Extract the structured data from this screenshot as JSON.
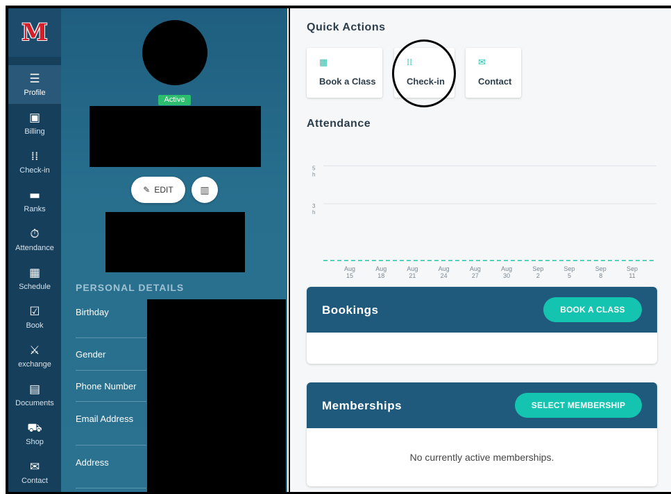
{
  "sidebar": {
    "logo": "M",
    "items": [
      {
        "label": "Profile",
        "icon": "profile-icon",
        "glyph": "☰"
      },
      {
        "label": "Billing",
        "icon": "billing-icon",
        "glyph": "▣"
      },
      {
        "label": "Check-in",
        "icon": "checkin-icon",
        "glyph": "⁞⁞"
      },
      {
        "label": "Ranks",
        "icon": "ranks-icon",
        "glyph": "▬"
      },
      {
        "label": "Attendance",
        "icon": "stopwatch-icon",
        "glyph": "⏱"
      },
      {
        "label": "Schedule",
        "icon": "calendar-icon",
        "glyph": "▦"
      },
      {
        "label": "Book",
        "icon": "checkbox-icon",
        "glyph": "☑"
      },
      {
        "label": "exchange",
        "icon": "martial-arts-icon",
        "glyph": "⚔"
      },
      {
        "label": "Documents",
        "icon": "document-icon",
        "glyph": "▤"
      },
      {
        "label": "Shop",
        "icon": "cart-icon",
        "glyph": "⛟"
      },
      {
        "label": "Contact",
        "icon": "envelope-icon",
        "glyph": "✉"
      }
    ]
  },
  "profile": {
    "status": "Active",
    "edit_label": "EDIT",
    "section_title": "PERSONAL DETAILS",
    "details": [
      "Birthday",
      "Gender",
      "Phone Number",
      "Email Address",
      "Address"
    ]
  },
  "quick_actions": {
    "title": "Quick Actions",
    "cards": [
      {
        "label": "Book a Class",
        "icon": "calendar-icon"
      },
      {
        "label": "Check-in",
        "icon": "keypad-icon"
      },
      {
        "label": "Contact",
        "icon": "envelope-icon"
      }
    ]
  },
  "attendance": {
    "title": "Attendance"
  },
  "chart_data": {
    "type": "line",
    "categories": [
      "Aug 15",
      "Aug 18",
      "Aug 21",
      "Aug 24",
      "Aug 27",
      "Aug 30",
      "Sep 2",
      "Sep 5",
      "Sep 8",
      "Sep 11"
    ],
    "x_ticks": [
      [
        "Aug",
        "15"
      ],
      [
        "Aug",
        "18"
      ],
      [
        "Aug",
        "21"
      ],
      [
        "Aug",
        "24"
      ],
      [
        "Aug",
        "27"
      ],
      [
        "Aug",
        "30"
      ],
      [
        "Sep",
        "2"
      ],
      [
        "Sep",
        "5"
      ],
      [
        "Sep",
        "8"
      ],
      [
        "Sep",
        "11"
      ]
    ],
    "y_ticks": [
      [
        "5",
        "h"
      ],
      [
        "3",
        "h"
      ]
    ],
    "values": [
      0,
      0,
      0,
      0,
      0,
      0,
      0,
      0,
      0,
      0
    ],
    "ylim": [
      0,
      6
    ],
    "gridlines": [
      3,
      5
    ],
    "series_color": "#27c2ad"
  },
  "bookings": {
    "title": "Bookings",
    "button": "BOOK A CLASS"
  },
  "memberships": {
    "title": "Memberships",
    "button": "SELECT MEMBERSHIP",
    "empty": "No currently active memberships."
  },
  "colors": {
    "sidebar": "#163f5c",
    "accent": "#14c4b0",
    "panel_header": "#1f5a7c",
    "active_badge": "#2dbd6e"
  }
}
